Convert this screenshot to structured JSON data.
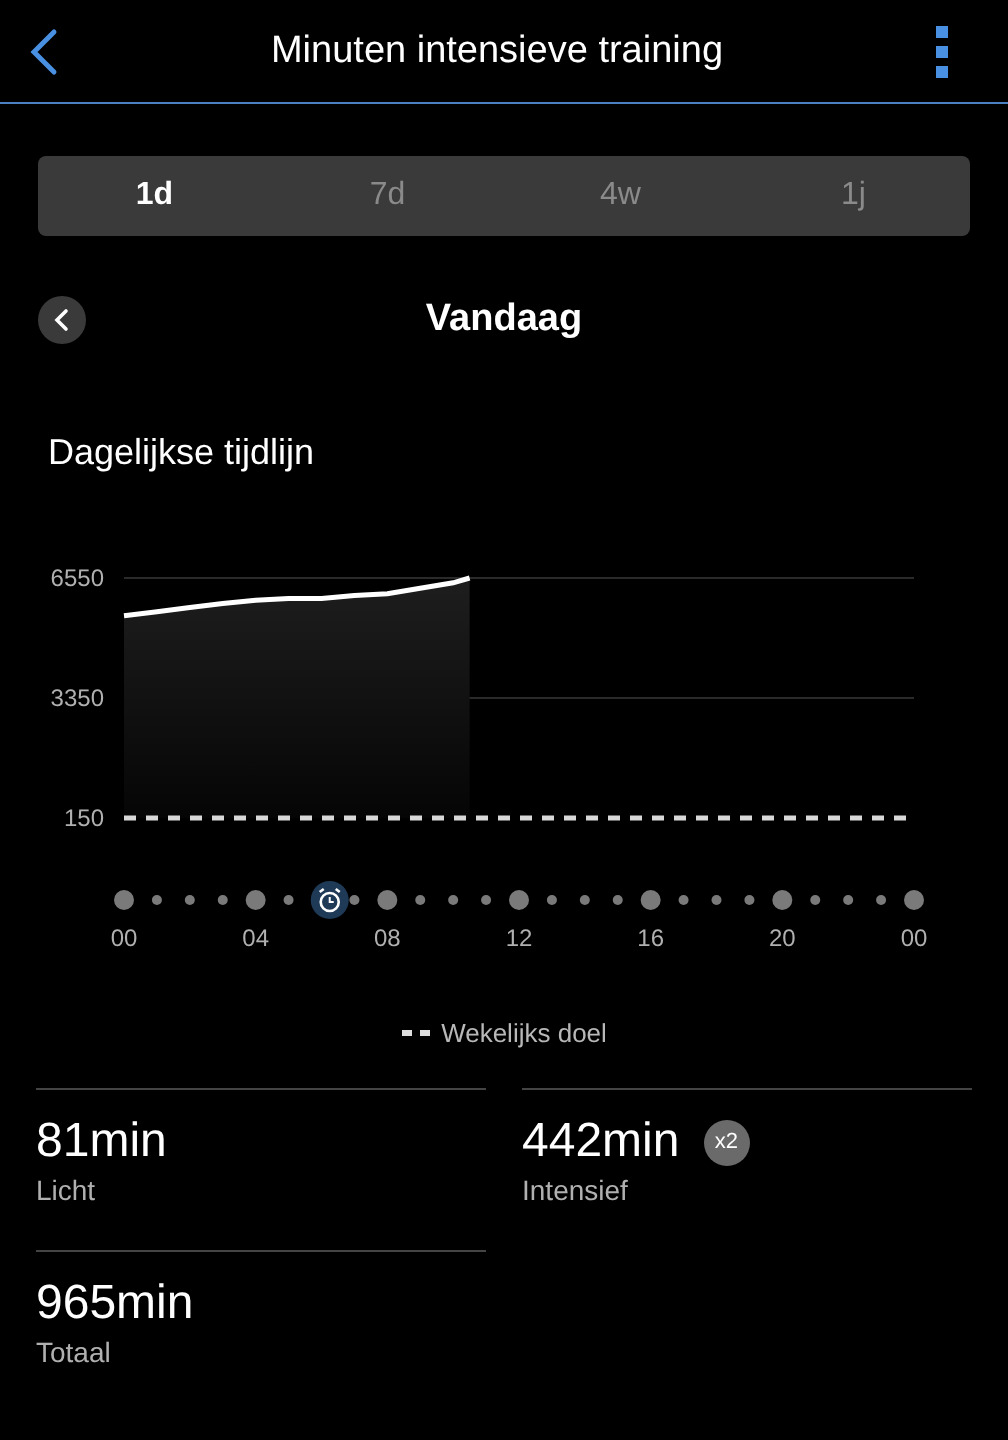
{
  "header": {
    "title": "Minuten intensieve training"
  },
  "tabs": [
    {
      "label": "1d",
      "selected": true
    },
    {
      "label": "7d",
      "selected": false
    },
    {
      "label": "4w",
      "selected": false
    },
    {
      "label": "1j",
      "selected": false
    }
  ],
  "period": {
    "title": "Vandaag"
  },
  "timeline": {
    "title": "Dagelijkse tijdlijn",
    "chart_data": {
      "type": "area",
      "x": [
        0,
        1,
        2,
        3,
        4,
        5,
        6,
        7,
        8,
        9,
        10,
        10.5
      ],
      "series": [
        {
          "color": "#ffffff",
          "values": [
            5540,
            5650,
            5760,
            5870,
            5960,
            6000,
            6000,
            6080,
            6130,
            6280,
            6420,
            6550
          ]
        }
      ],
      "xlim": [
        0,
        24
      ],
      "ylim": [
        150,
        6550
      ],
      "xticks": [
        {
          "value": 0,
          "label": "00"
        },
        {
          "value": 4,
          "label": "04"
        },
        {
          "value": 8,
          "label": "08"
        },
        {
          "value": 12,
          "label": "12"
        },
        {
          "value": 16,
          "label": "16"
        },
        {
          "value": 20,
          "label": "20"
        },
        {
          "value": 24,
          "label": "00"
        }
      ],
      "yticks": [
        150,
        3350,
        6550
      ],
      "ref_lines": [
        {
          "label": "Wekelijks doel"
        }
      ]
    }
  },
  "stats": [
    {
      "value": "81min",
      "label": "Licht"
    },
    {
      "value": "442min",
      "label": "Intensief",
      "badge": "x2"
    },
    {
      "value": "965min",
      "label": "Totaal"
    }
  ]
}
